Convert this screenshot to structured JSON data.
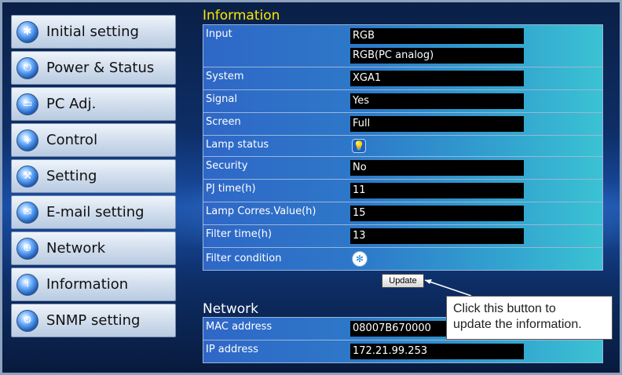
{
  "sidebar": {
    "items": [
      {
        "label": "Initial setting",
        "icon": "gear-icon"
      },
      {
        "label": "Power & Status",
        "icon": "power-icon"
      },
      {
        "label": "PC Adj.",
        "icon": "monitor-icon"
      },
      {
        "label": "Control",
        "icon": "remote-icon"
      },
      {
        "label": "Setting",
        "icon": "wrench-icon"
      },
      {
        "label": "E-mail setting",
        "icon": "mail-icon"
      },
      {
        "label": "Network",
        "icon": "network-icon"
      },
      {
        "label": "Information",
        "icon": "info-icon"
      },
      {
        "label": "SNMP setting",
        "icon": "snmp-icon"
      }
    ]
  },
  "information": {
    "title": "Information",
    "rows": [
      {
        "label": "Input",
        "values": [
          "RGB",
          "RGB(PC analog)"
        ]
      },
      {
        "label": "System",
        "value": "XGA1"
      },
      {
        "label": "Signal",
        "value": "Yes"
      },
      {
        "label": "Screen",
        "value": "Full"
      },
      {
        "label": "Lamp status",
        "icon": "lamp-icon"
      },
      {
        "label": "Security",
        "value": "No"
      },
      {
        "label": "PJ time(h)",
        "value": "11"
      },
      {
        "label": "Lamp Corres.Value(h)",
        "value": "15"
      },
      {
        "label": "Filter time(h)",
        "value": "13"
      },
      {
        "label": "Filter condition",
        "icon": "filter-icon"
      }
    ],
    "update_label": "Update"
  },
  "network": {
    "title": "Network",
    "rows": [
      {
        "label": "MAC address",
        "value": "08007B670000"
      },
      {
        "label": "IP address",
        "value": "172.21.99.253"
      }
    ]
  },
  "callout": {
    "line1": "Click this button to",
    "line2": "update the information."
  }
}
